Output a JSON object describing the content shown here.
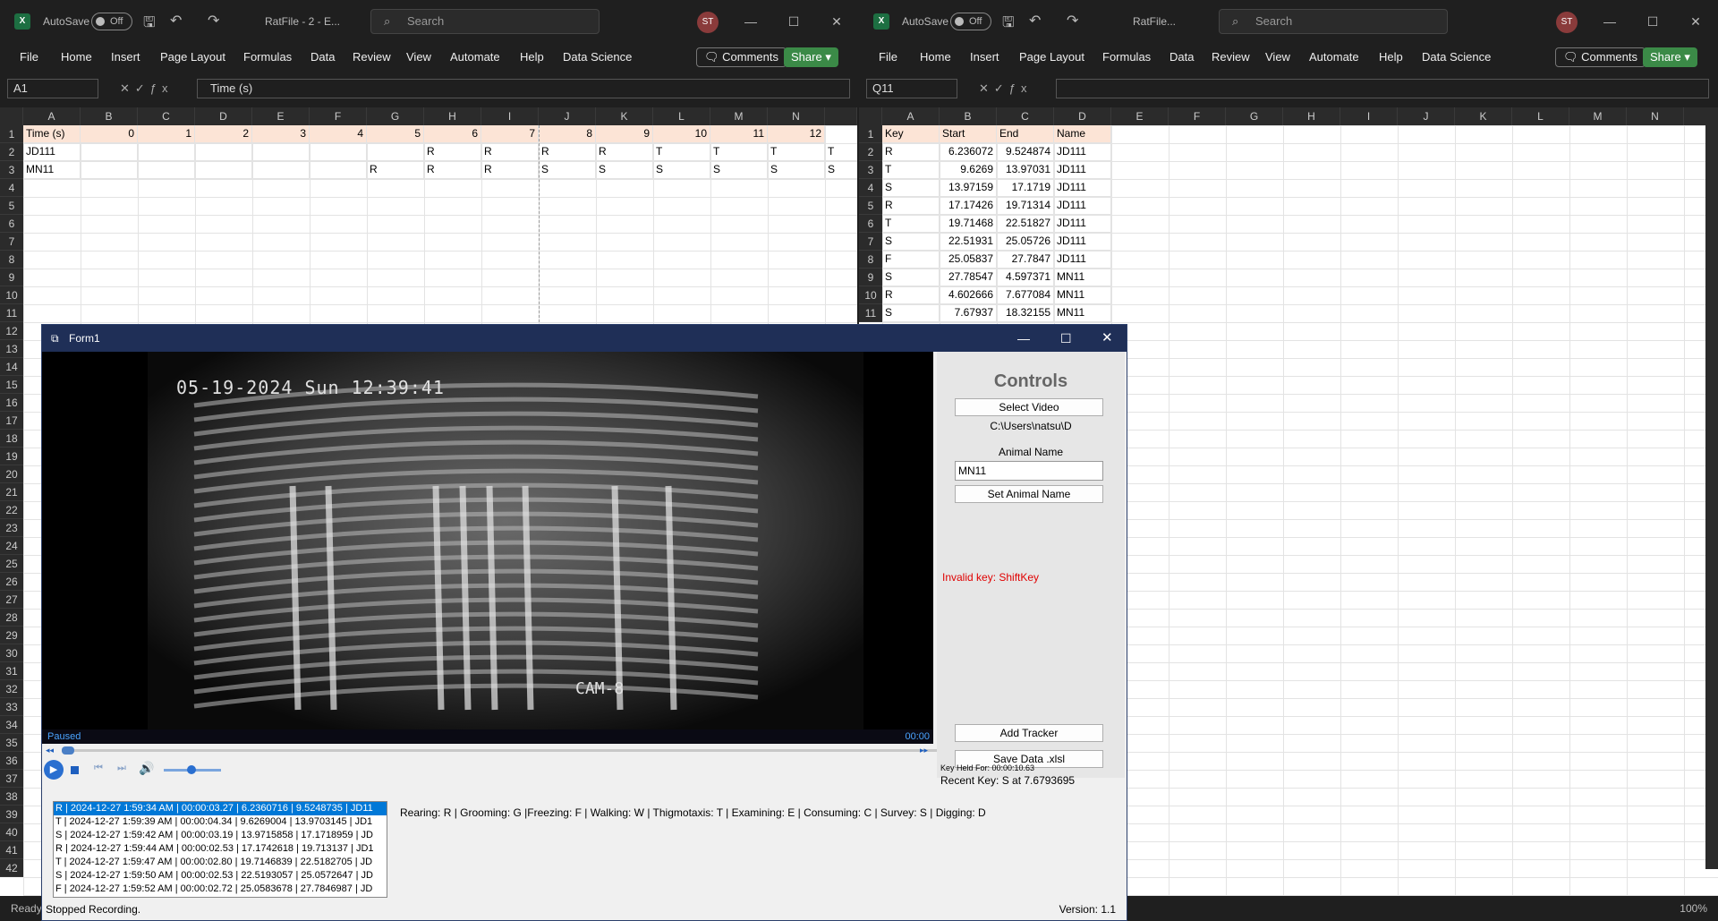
{
  "left": {
    "autosave": "AutoSave",
    "toggle": "Off",
    "title": "RatFile - 2 - E...",
    "search": "Search",
    "avatar": "ST",
    "menu": [
      "File",
      "Home",
      "Insert",
      "Page Layout",
      "Formulas",
      "Data",
      "Review",
      "View",
      "Automate",
      "Help",
      "Data Science"
    ],
    "comments": "Comments",
    "share": "Share",
    "namebox": "A1",
    "formula": "Time (s)",
    "columns": [
      "A",
      "B",
      "C",
      "D",
      "E",
      "F",
      "G",
      "H",
      "I",
      "J",
      "K",
      "L",
      "M",
      "N"
    ],
    "rows": [
      "1",
      "2",
      "3",
      "4",
      "5",
      "6",
      "7",
      "8",
      "9",
      "10",
      "11",
      "12",
      "13",
      "14",
      "15",
      "16",
      "17",
      "18",
      "19",
      "20",
      "21",
      "22",
      "23",
      "24",
      "25",
      "26",
      "27",
      "28",
      "29",
      "30",
      "31",
      "32",
      "33",
      "34",
      "35",
      "36",
      "37",
      "38",
      "39",
      "40",
      "41",
      "42"
    ],
    "cells": [
      [
        "Time (s)",
        "0",
        "1",
        "2",
        "3",
        "4",
        "5",
        "6",
        "7",
        "8",
        "9",
        "10",
        "11",
        "12"
      ],
      [
        "JD111",
        "",
        "",
        "",
        "",
        "",
        "",
        "R",
        "R",
        "R",
        "R",
        "T",
        "T",
        "T",
        "T"
      ],
      [
        "MN11",
        "",
        "",
        "",
        "",
        "",
        "R",
        "R",
        "R",
        "S",
        "S",
        "S",
        "S",
        "S",
        "S"
      ]
    ],
    "status": "Ready"
  },
  "right": {
    "autosave": "AutoSave",
    "toggle": "Off",
    "title": "RatFile...",
    "search": "Search",
    "avatar": "ST",
    "menu": [
      "File",
      "Home",
      "Insert",
      "Page Layout",
      "Formulas",
      "Data",
      "Review",
      "View",
      "Automate",
      "Help",
      "Data Science"
    ],
    "comments": "Comments",
    "share": "Share",
    "namebox": "Q11",
    "formula": "",
    "columns": [
      "A",
      "B",
      "C",
      "D",
      "E",
      "F",
      "G",
      "H",
      "I",
      "J",
      "K",
      "L",
      "M",
      "N"
    ],
    "rows": [
      "1",
      "2",
      "3",
      "4",
      "5",
      "6",
      "7",
      "8",
      "9",
      "10",
      "11"
    ],
    "cells": [
      [
        "Key",
        "Start",
        "End",
        "Name"
      ],
      [
        "R",
        "6.236072",
        "9.524874",
        "JD111"
      ],
      [
        "T",
        "9.6269",
        "13.97031",
        "JD111"
      ],
      [
        "S",
        "13.97159",
        "17.1719",
        "JD111"
      ],
      [
        "R",
        "17.17426",
        "19.71314",
        "JD111"
      ],
      [
        "T",
        "19.71468",
        "22.51827",
        "JD111"
      ],
      [
        "S",
        "22.51931",
        "25.05726",
        "JD111"
      ],
      [
        "F",
        "25.05837",
        "27.7847",
        "JD111"
      ],
      [
        "S",
        "27.78547",
        "4.597371",
        "MN11"
      ],
      [
        "R",
        "4.602666",
        "7.677084",
        "MN11"
      ],
      [
        "S",
        "7.67937",
        "18.32155",
        "MN11"
      ]
    ],
    "zoom": "100%"
  },
  "form": {
    "title": "Form1",
    "osd_time": "05-19-2024 Sun 12:39:41",
    "osd_cam": "CAM-8",
    "paused": "Paused",
    "time": "00:00",
    "controls_title": "Controls",
    "select_video": "Select Video",
    "path": "C:\\Users\\natsu\\D",
    "animal_label": "Animal Name",
    "animal_value": "MN11",
    "set_animal": "Set Animal Name",
    "invalid": "Invalid key: ShiftKey",
    "add_tracker": "Add Tracker",
    "save_data": "Save Data .xlsl",
    "key_held": "Key Held For: 00:00:10.63",
    "recent_key": "Recent Key: S at 7.6793695",
    "log": [
      "R | 2024-12-27 1:59:34 AM | 00:00:03.27 | 6.2360716 | 9.5248735 | JD11",
      "T | 2024-12-27 1:59:39 AM | 00:00:04.34 | 9.6269004 | 13.9703145 | JD1",
      "S | 2024-12-27 1:59:42 AM | 00:00:03.19 | 13.9715858 | 17.1718959 | JD",
      "R | 2024-12-27 1:59:44 AM | 00:00:02.53 | 17.1742618 | 19.713137 | JD1",
      "T | 2024-12-27 1:59:47 AM | 00:00:02.80 | 19.7146839 | 22.5182705 | JD",
      "S | 2024-12-27 1:59:50 AM | 00:00:02.53 | 22.5193057 | 25.0572647 | JD",
      "F | 2024-12-27 1:59:52 AM | 00:00:02.72 | 25.0583678 | 27.7846987 | JD"
    ],
    "legend": "Rearing: R | Grooming: G |Freezing: F | Walking: W | Thigmotaxis: T | Examining: E | Consuming: C | Survey: S | Digging: D",
    "status": "Stopped Recording.",
    "version": "Version: 1.1"
  },
  "colors": {
    "accent_green": "#3b8a47",
    "title_blue": "#1f2f57",
    "invalid_red": "#e00000",
    "select_blue": "#0078d7"
  }
}
